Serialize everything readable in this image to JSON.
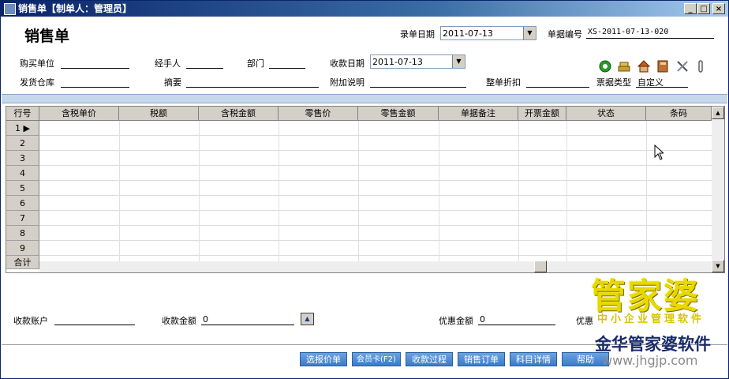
{
  "window": {
    "title": "销售单【制单人：管理员】",
    "min_label": "_",
    "max_label": "□",
    "close_label": "×"
  },
  "header": {
    "title": "销售单",
    "entry_date_label": "录单日期",
    "entry_date_value": "2011-07-13",
    "doc_no_label": "单据编号",
    "doc_no_value": "XS-2011-07-13-020"
  },
  "form": {
    "buyer_label": "购买单位",
    "handler_label": "经手人",
    "dept_label": "部门",
    "receipt_date_label": "收款日期",
    "receipt_date_value": "2011-07-13",
    "warehouse_label": "发货仓库",
    "summary_label": "摘要",
    "extra_note_label": "附加说明",
    "discount_label": "整单折扣",
    "ticket_type_label": "票据类型",
    "ticket_type_value": "自定义"
  },
  "grid": {
    "columns": [
      "行号",
      "含税单价",
      "税额",
      "含税金额",
      "零售价",
      "零售金额",
      "单据备注",
      "开票金额",
      "状态",
      "条码"
    ],
    "rows": [
      "1",
      "2",
      "3",
      "4",
      "5",
      "6",
      "7",
      "8",
      "9"
    ],
    "total_label": "合计"
  },
  "footer": {
    "account_label": "收款账户",
    "amount_label": "收款金额",
    "amount_value": "0",
    "discount_amt_label": "优惠金额",
    "discount_amt_value": "0",
    "discount2_label": "优惠"
  },
  "buttons": [
    "选报价单",
    "会员卡(F2)",
    "收款过程",
    "销售订单",
    "科目详情",
    "帮助"
  ],
  "watermark": {
    "brand": "管家婆",
    "slogan": "中小企业管理软件",
    "company": "金华管家婆软件",
    "url": "www.jhgjp.com"
  },
  "icons": [
    "green-circle-icon",
    "coins-icon",
    "house-icon",
    "book-icon",
    "tools-icon",
    "clip-icon"
  ],
  "colors": {
    "accent": "#3b7cc8",
    "titlebar": "#0a246a",
    "brand": "#e8d800"
  }
}
